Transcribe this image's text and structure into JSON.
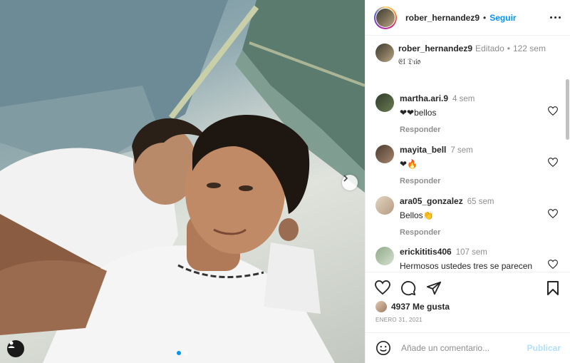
{
  "post": {
    "author": "rober_hernandez9",
    "follow_label": "Seguir",
    "separator": "•",
    "caption_edited": "Editado",
    "caption_age": "122 sem",
    "caption_text": "𝔈𝔩 𝔇𝔲́𝔬"
  },
  "comments": [
    {
      "user": "martha.ari.9",
      "age": "4 sem",
      "text": "❤❤bellos",
      "reply": "Responder"
    },
    {
      "user": "mayita_bell",
      "age": "7 sem",
      "text": "❤🔥",
      "reply": "Responder"
    },
    {
      "user": "ara05_gonzalez",
      "age": "65 sem",
      "text": "Bellos👏",
      "reply": "Responder"
    },
    {
      "user": "erickititis406",
      "age": "107 sem",
      "text": "Hermosos ustedes tres se parecen",
      "reply": ""
    }
  ],
  "stats": {
    "likes": "4937 Me gusta",
    "date": "ENERO 31, 2021"
  },
  "composer": {
    "placeholder": "Añade un comentario...",
    "publish_label": "Publicar"
  },
  "colors": {
    "accent": "#0095f6",
    "like_red": "#ed4956",
    "muted": "#8e8e8e"
  },
  "icons": [
    "more-icon",
    "heart-icon",
    "comment-icon",
    "share-icon",
    "bookmark-icon",
    "emoji-icon",
    "tag-user-icon",
    "chevron-right-icon"
  ]
}
